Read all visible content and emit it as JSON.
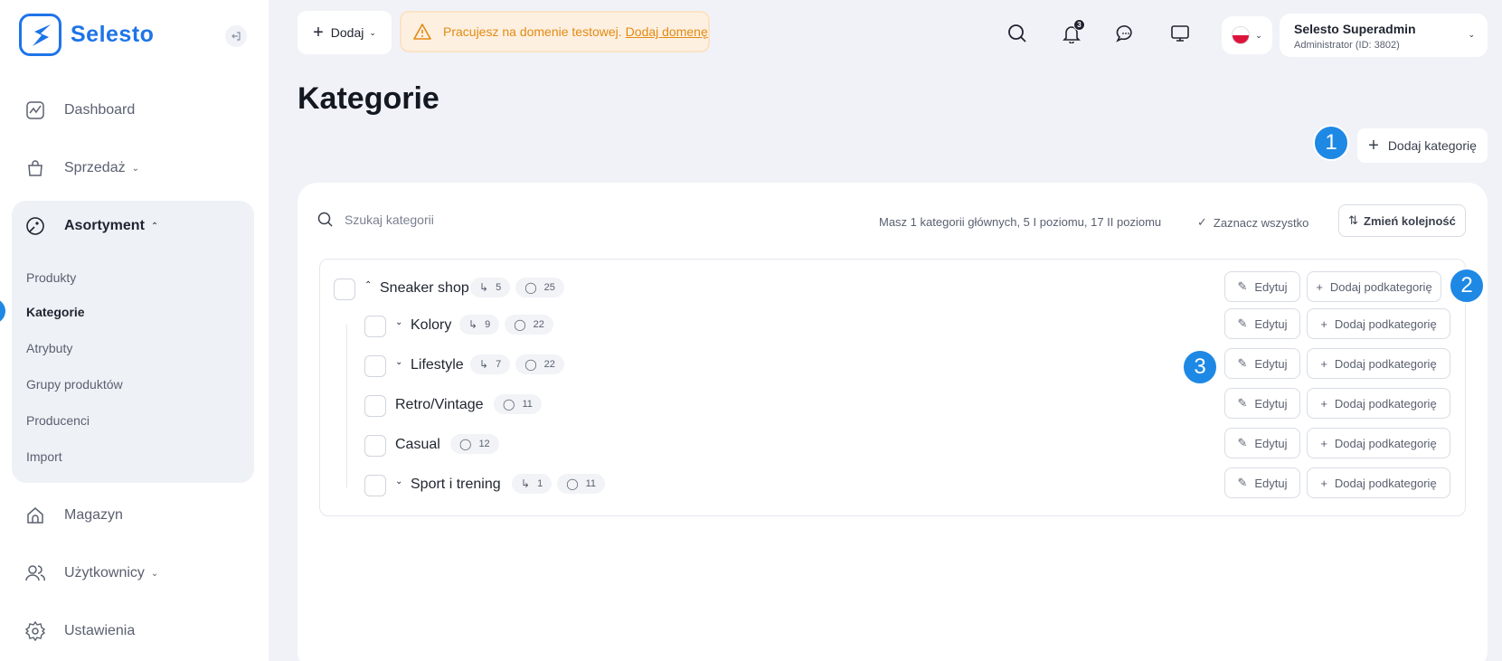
{
  "app": {
    "name": "Selesto"
  },
  "sidebar": {
    "items": [
      {
        "label": "Dashboard",
        "icon": "chart-line-icon"
      },
      {
        "label": "Sprzedaż",
        "icon": "shopping-bag-icon",
        "expandable": true
      },
      {
        "label": "Asortyment",
        "icon": "tag-icon",
        "expanded": true
      },
      {
        "label": "Magazyn",
        "icon": "warehouse-icon"
      },
      {
        "label": "Użytkownicy",
        "icon": "users-icon",
        "expandable": true
      },
      {
        "label": "Ustawienia",
        "icon": "gear-icon"
      }
    ],
    "asortyment_sub": [
      "Produkty",
      "Kategorie",
      "Atrybuty",
      "Grupy produktów",
      "Producenci",
      "Import"
    ],
    "active_sub": "Kategorie"
  },
  "topbar": {
    "add_label": "Dodaj",
    "warning_text": "Pracujesz na domenie testowej.",
    "warning_link": "Dodaj domenę",
    "notifications_count": "3",
    "user_name": "Selesto Superadmin",
    "user_role": "Administrator (ID: 3802)"
  },
  "page": {
    "title": "Kategorie",
    "add_category_label": "Dodaj kategorię",
    "search_placeholder": "Szukaj kategorii",
    "summary": "Masz 1 kategorii głównych, 5 I poziomu, 17 II poziomu",
    "select_all_label": "Zaznacz wszystko",
    "reorder_label": "Zmień kolejność",
    "edit_label": "Edytuj",
    "add_sub_label": "Dodaj podkategorię"
  },
  "steps": [
    "1",
    "2",
    "3"
  ],
  "categories": [
    {
      "name": "Sneaker shop",
      "subcount": "5",
      "products": "25",
      "level": 0,
      "expanded": true
    },
    {
      "name": "Kolory",
      "subcount": "9",
      "products": "22",
      "level": 1,
      "expandable": true
    },
    {
      "name": "Lifestyle",
      "subcount": "7",
      "products": "22",
      "level": 1,
      "expandable": true
    },
    {
      "name": "Retro/Vintage",
      "products": "11",
      "level": 1
    },
    {
      "name": "Casual",
      "products": "12",
      "level": 1
    },
    {
      "name": "Sport i trening",
      "subcount": "1",
      "products": "11",
      "level": 1,
      "expandable": true
    }
  ],
  "colors": {
    "accent": "#1e88e5",
    "brand": "#1e74e8",
    "warning": "#e38a12"
  }
}
